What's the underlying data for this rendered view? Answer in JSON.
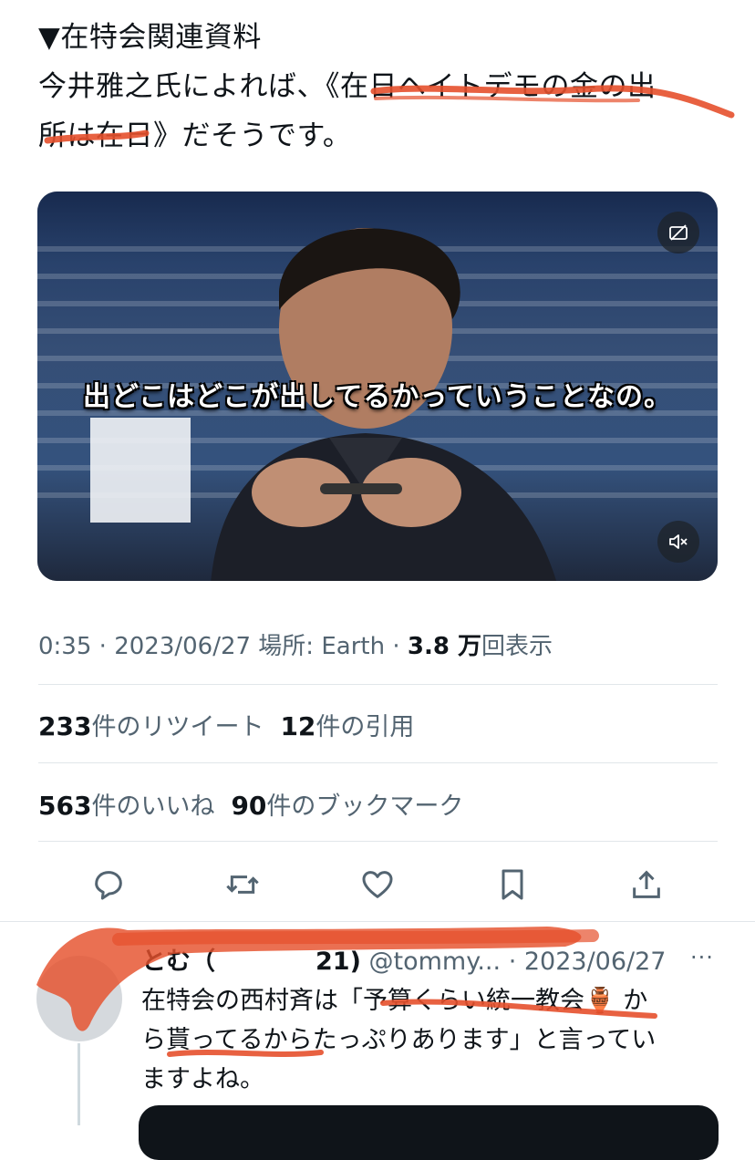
{
  "tweet": {
    "line1": "▼在特会関連資料",
    "line2": "今井雅之氏によれば、《在日ヘイトデモの金の出",
    "line3": "所は在日》だそうです。"
  },
  "video": {
    "subtitle": "出どこはどこが出してるかっていうことなの。"
  },
  "meta": {
    "time": "0:35",
    "sep1": " · ",
    "date": "2023/06/27",
    "location": " 場所: Earth",
    "sep2": " · ",
    "views_count": "3.8 万",
    "views_label": "回表示"
  },
  "stats": {
    "retweets_count": "233",
    "retweets_label": "件のリツイート",
    "quotes_count": "12",
    "quotes_label": "件の引用",
    "likes_count": "563",
    "likes_label": "件のいいね",
    "bookmarks_count": "90",
    "bookmarks_label": "件のブックマーク"
  },
  "actions": {
    "icons": [
      "reply-icon",
      "retweet-icon",
      "like-icon",
      "bookmark-icon",
      "share-icon"
    ]
  },
  "reply": {
    "name": "とむ（",
    "name_tail": "21)",
    "handle": "@tommy...",
    "sep": " · ",
    "date": "2023/06/27",
    "more": "···",
    "body_line1": "在特会の西村斉は「予算くらい統一教会",
    "body_emoji": "🏺",
    "body_line1_tail": " か",
    "body_line2": "ら貰ってるからたっぷりあります」と言ってい",
    "body_line3": "ますよね。"
  },
  "colors": {
    "text": "#0f1419",
    "muted": "#536471",
    "divider": "#e1e6ea",
    "highlight": "#e5502c"
  }
}
